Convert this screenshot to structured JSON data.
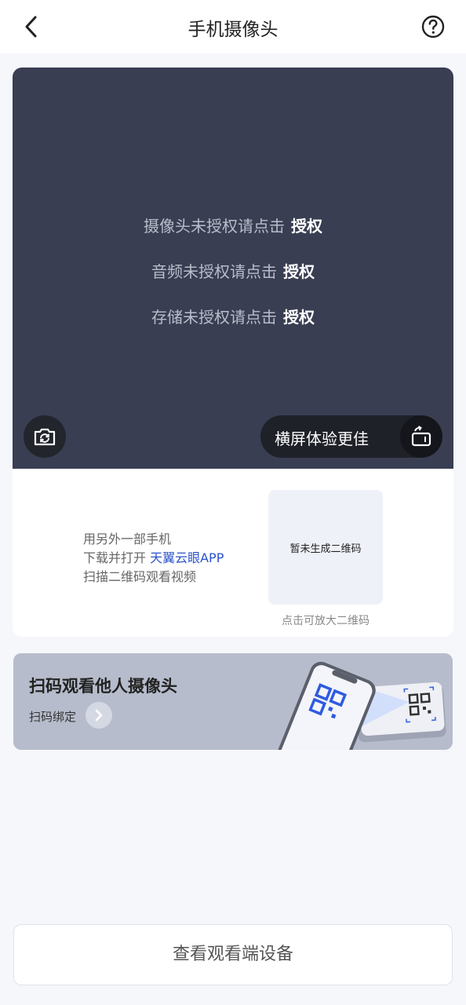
{
  "header": {
    "title": "手机摄像头"
  },
  "camera": {
    "auth_camera_text": "摄像头未授权请点击",
    "auth_audio_text": "音频未授权请点击",
    "auth_storage_text": "存储未授权请点击",
    "auth_link_label": "授权",
    "landscape_label": "横屏体验更佳"
  },
  "share": {
    "line1": "用另外一部手机",
    "line2_prefix": "下载并打开 ",
    "line2_app": "天翼云眼APP",
    "line3": "扫描二维码观看视频",
    "qr_placeholder": "暂未生成二维码",
    "qr_hint": "点击可放大二维码"
  },
  "scan_banner": {
    "title": "扫码观看他人摄像头",
    "subtitle": "扫码绑定"
  },
  "footer": {
    "devices_button": "查看观看端设备"
  },
  "colors": {
    "camera_bg": "#393e52",
    "link_blue": "#2b53c8",
    "banner_bg": "#b6bccb"
  }
}
